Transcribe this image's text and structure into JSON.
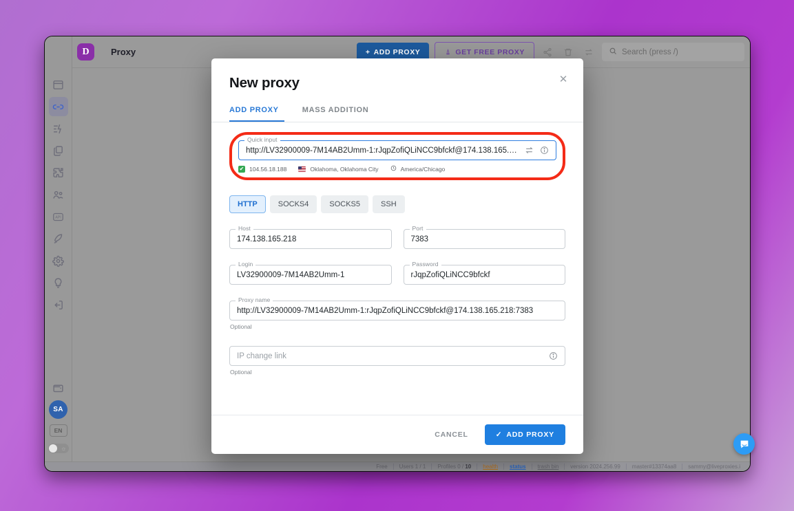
{
  "app": {
    "brand_initial": "D",
    "page_title": "Proxy",
    "accent_blue": "#1f7fe0",
    "brand_purple": "#8a2fa8",
    "annotation_red": "#f42b17"
  },
  "topbar": {
    "add_proxy_label": "ADD PROXY",
    "add_proxy_plus": "+",
    "get_free_proxy_label": "GET FREE PROXY",
    "share_icon": "share-icon",
    "trash_icon": "trash-icon",
    "transfer_icon": "transfer-icon",
    "search_placeholder": "Search (press /)"
  },
  "sidebar": {
    "items": [
      {
        "name": "browser-icon",
        "label": "Browser profiles",
        "active": false
      },
      {
        "name": "link-icon",
        "label": "Proxy",
        "active": true
      },
      {
        "name": "automation-icon",
        "label": "Automation",
        "active": false
      },
      {
        "name": "copy-icon",
        "label": "Templates",
        "active": false
      },
      {
        "name": "puzzle-icon",
        "label": "Extensions",
        "active": false
      },
      {
        "name": "team-icon",
        "label": "Team",
        "active": false
      },
      {
        "name": "api-icon",
        "label": "API",
        "active": false
      },
      {
        "name": "rocket-icon",
        "label": "Quick start",
        "active": false
      },
      {
        "name": "gear-icon",
        "label": "Settings",
        "active": false
      },
      {
        "name": "bulb-icon",
        "label": "Tips",
        "active": false
      },
      {
        "name": "logout-icon",
        "label": "Logout",
        "active": false
      }
    ],
    "wallet_icon": "wallet-icon",
    "avatar_initials": "SA",
    "language": "EN",
    "theme_toggle": "theme-toggle"
  },
  "statusbar": {
    "plan": "Free",
    "users": "Users 1 / 1",
    "profiles_prefix": "Profiles 0 / ",
    "profiles_total": "10",
    "health": "health",
    "status": "status",
    "trash_bin": "trash bin",
    "version": "version 2024.256.99",
    "build": "master#13374aa8",
    "account": "sammy@liveproxies.i"
  },
  "modal": {
    "title": "New proxy",
    "close_icon": "close-icon",
    "tabs": [
      {
        "label": "ADD PROXY",
        "active": true
      },
      {
        "label": "MASS ADDITION",
        "active": false
      }
    ],
    "quick_input": {
      "legend": "Quick input",
      "value": "http://LV32900009-7M14AB2Umm-1:rJqpZofiQLiNCC9bfckf@174.138.165.218:7383",
      "swap_icon": "swap-icon",
      "info_icon": "info-icon",
      "meta": {
        "check": "✔",
        "ip": "104.56.18.188",
        "flag": "us-flag-icon",
        "location": "Oklahoma, Oklahoma City",
        "clock_icon": "clock-icon",
        "timezone": "America/Chicago"
      }
    },
    "protocols": [
      {
        "label": "HTTP",
        "active": true
      },
      {
        "label": "SOCKS4",
        "active": false
      },
      {
        "label": "SOCKS5",
        "active": false
      },
      {
        "label": "SSH",
        "active": false
      }
    ],
    "fields": {
      "host": {
        "legend": "Host",
        "value": "174.138.165.218"
      },
      "port": {
        "legend": "Port",
        "value": "7383"
      },
      "login": {
        "legend": "Login",
        "value": "LV32900009-7M14AB2Umm-1"
      },
      "password": {
        "legend": "Password",
        "value": "rJqpZofiQLiNCC9bfckf"
      },
      "proxy_name": {
        "legend": "Proxy name",
        "value": "http://LV32900009-7M14AB2Umm-1:rJqpZofiQLiNCC9bfckf@174.138.165.218:7383",
        "hint": "Optional"
      },
      "ip_change_link": {
        "placeholder": "IP change link",
        "value": "",
        "hint": "Optional",
        "info_icon": "info-icon"
      }
    },
    "footer": {
      "cancel_label": "CANCEL",
      "submit_label": "ADD PROXY",
      "submit_check": "✓"
    }
  },
  "chat": {
    "icon": "chat-bubble-icon"
  }
}
